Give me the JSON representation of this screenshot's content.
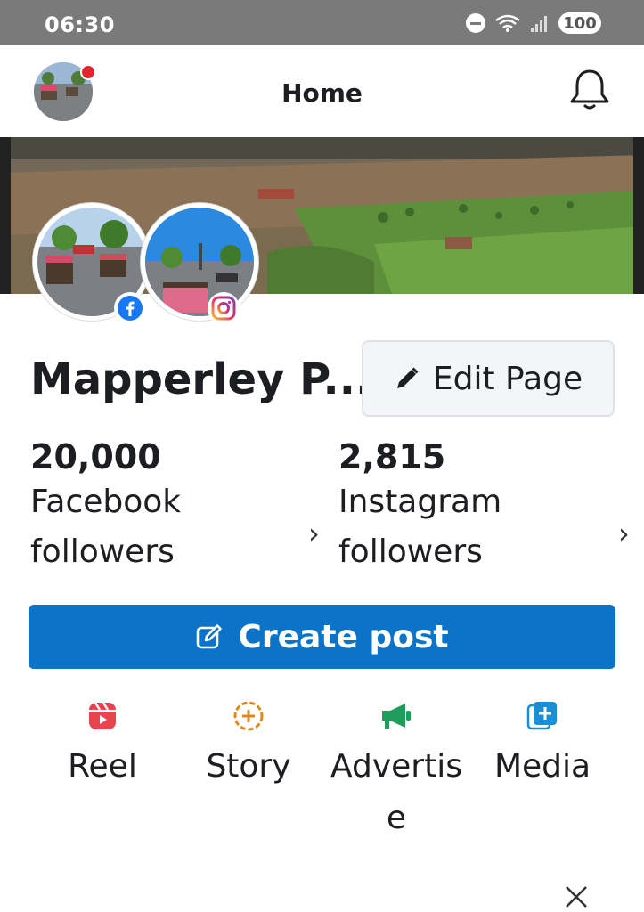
{
  "status_bar": {
    "time": "06:30",
    "battery": "100",
    "icons": [
      "dnd-icon",
      "wifi-icon",
      "signal-icon",
      "battery-icon"
    ]
  },
  "header": {
    "title": "Home",
    "avatar_has_notification_dot": true,
    "icons": [
      "avatar",
      "bell-icon"
    ]
  },
  "profile": {
    "page_name": "Mapperley P...",
    "edit_button_label": "Edit Page",
    "facebook_followers": {
      "count": "20,000",
      "label": "Facebook followers"
    },
    "instagram_followers": {
      "count": "2,815",
      "label": "Instagram followers"
    }
  },
  "create_post_label": "Create post",
  "actions": [
    {
      "label": "Reel",
      "icon": "reel-icon",
      "color": "#e8434f"
    },
    {
      "label": "Story",
      "icon": "story-plus-icon",
      "color": "#e08a1e"
    },
    {
      "label": "Advertise",
      "icon": "megaphone-icon",
      "color": "#1f9c5a"
    },
    {
      "label": "Media",
      "icon": "media-add-icon",
      "color": "#1b8fd6"
    }
  ],
  "colors": {
    "status_bar": "#7a7a7a",
    "primary_button": "#0b74c9",
    "notification_dot": "#e0272f",
    "facebook_blue": "#1877f2"
  }
}
